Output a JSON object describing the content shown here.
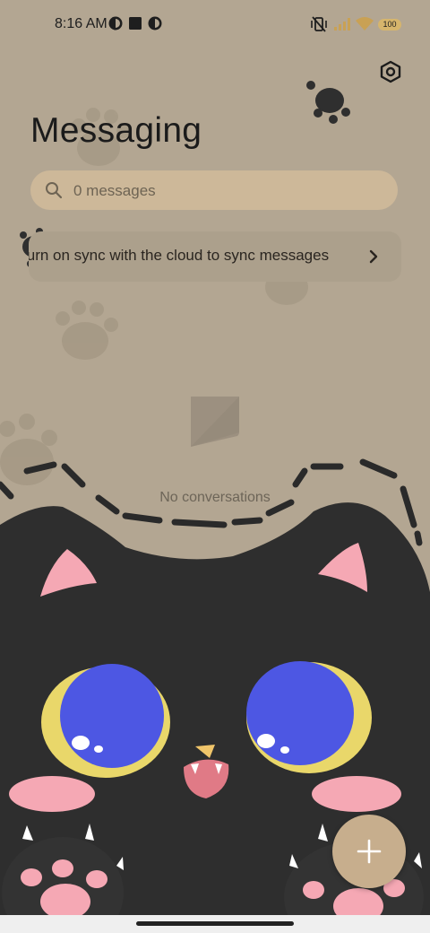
{
  "status_bar": {
    "time": "8:16 AM",
    "battery": "100",
    "icons": [
      "notification-app-icon",
      "square-notification-icon",
      "notification-app-icon",
      "vibrate-off-icon",
      "signal-icon",
      "wifi-icon",
      "battery-icon"
    ]
  },
  "header": {
    "title": "Messaging",
    "settings_icon": "settings-hexagon-icon"
  },
  "search": {
    "placeholder": "0 messages",
    "icon": "search-icon"
  },
  "sync_banner": {
    "text": "Turn on sync with the cloud to sync messages",
    "icon": "chevron-right-icon"
  },
  "empty_state": {
    "icon": "message-bubble-icon",
    "text": "No conversations"
  },
  "fab": {
    "icon": "plus-icon"
  },
  "colors": {
    "background": "#b3a692",
    "search_bg": "#cdb899",
    "fab": "#c7ae8d",
    "cat_fur": "#2e2e2e",
    "cat_eye": "#4d57e3",
    "cat_eye_rim": "#e9d76a",
    "cat_blush": "#f5a8b4"
  }
}
